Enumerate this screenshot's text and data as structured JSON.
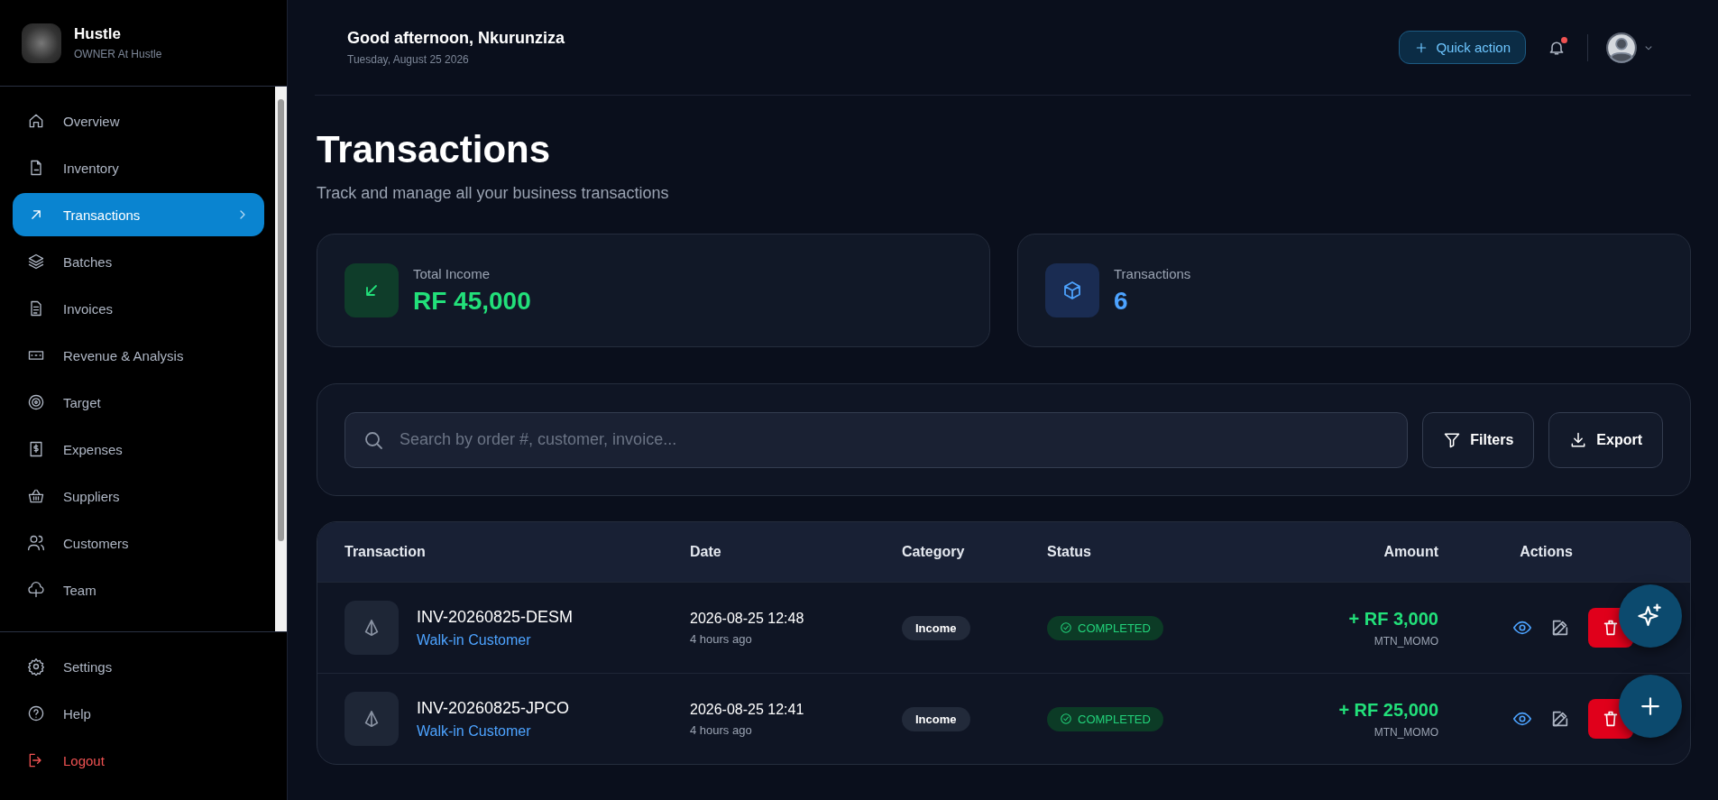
{
  "brand": {
    "name": "Hustle",
    "role": "OWNER At Hustle"
  },
  "nav": [
    {
      "label": "Overview",
      "selected": false
    },
    {
      "label": "Inventory",
      "selected": false
    },
    {
      "label": "Transactions",
      "selected": true
    },
    {
      "label": "Batches",
      "selected": false
    },
    {
      "label": "Invoices",
      "selected": false
    },
    {
      "label": "Revenue & Analysis",
      "selected": false
    },
    {
      "label": "Target",
      "selected": false
    },
    {
      "label": "Expenses",
      "selected": false
    },
    {
      "label": "Suppliers",
      "selected": false
    },
    {
      "label": "Customers",
      "selected": false
    },
    {
      "label": "Team",
      "selected": false
    }
  ],
  "nav_bottom": [
    {
      "label": "Settings",
      "kind": "normal"
    },
    {
      "label": "Help",
      "kind": "normal"
    },
    {
      "label": "Logout",
      "kind": "danger"
    }
  ],
  "header": {
    "greeting": "Good afternoon, Nkurunziza",
    "date": "Tuesday, August 25 2026",
    "quick_action": "Quick action",
    "unread": true
  },
  "page": {
    "title": "Transactions",
    "subtitle": "Track and manage all your business transactions"
  },
  "stats": [
    {
      "label": "Total Income",
      "value": "RF 45,000",
      "kind": "income"
    },
    {
      "label": "Transactions",
      "value": "6",
      "kind": "count"
    }
  ],
  "search": {
    "placeholder": "Search by order #, customer, invoice..."
  },
  "toolbar": [
    {
      "label": "Filters",
      "kind": "filter"
    },
    {
      "label": "Export",
      "kind": "export"
    }
  ],
  "table": {
    "columns": [
      "Transaction",
      "Date",
      "Category",
      "Status",
      "Amount",
      "Actions"
    ],
    "rows": [
      {
        "id": "INV-20260825-DESM",
        "customer": "Walk-in Customer",
        "date": "2026-08-25 12:48",
        "ago": "4 hours ago",
        "category": "Income",
        "status": "COMPLETED",
        "amount": "+ RF 3,000",
        "method": "MTN_MOMO"
      },
      {
        "id": "INV-20260825-JPCO",
        "customer": "Walk-in Customer",
        "date": "2026-08-25 12:41",
        "ago": "4 hours ago",
        "category": "Income",
        "status": "COMPLETED",
        "amount": "+ RF 25,000",
        "method": "MTN_MOMO"
      }
    ]
  }
}
